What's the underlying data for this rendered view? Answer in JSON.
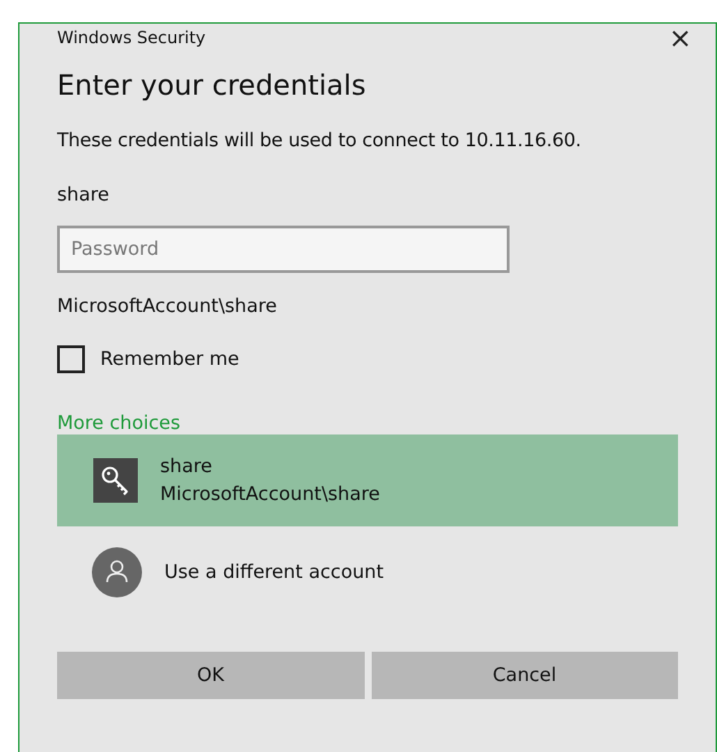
{
  "window": {
    "title": "Windows Security",
    "close": "×"
  },
  "heading": "Enter your credentials",
  "message": "These credentials will be used to connect to 10.11.16.60.",
  "username": "share",
  "password": {
    "placeholder": "Password"
  },
  "domain_user": "MicrosoftAccount\\share",
  "remember": {
    "label": "Remember me",
    "checked": false
  },
  "more_choices": "More choices",
  "accounts": [
    {
      "kind": "key",
      "name": "share",
      "detail": "MicrosoftAccount\\share",
      "selected": true
    },
    {
      "kind": "person",
      "name": "Use a different account",
      "selected": false
    }
  ],
  "buttons": [
    "OK",
    "Cancel"
  ]
}
